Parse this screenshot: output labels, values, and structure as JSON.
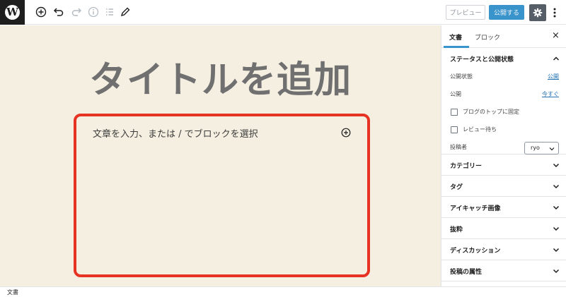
{
  "toolbar": {
    "logo_letter": "W",
    "logo_icon": "wordpress-logo-icon",
    "icons": [
      "add-block-icon",
      "undo-icon",
      "redo-icon",
      "info-icon",
      "list-view-icon",
      "edit-tools-icon"
    ],
    "preview_label": "プレビュー",
    "publish_label": "公開する",
    "settings_icon": "gear-icon",
    "more_icon": "more-vertical-icon"
  },
  "editor": {
    "title_placeholder": "タイトルを追加",
    "block_placeholder": "文章を入力、または / でブロックを選択",
    "highlight_color": "#e63323",
    "canvas_color": "#f4efe1"
  },
  "sidebar": {
    "tabs": {
      "document": "文書",
      "block": "ブロック",
      "close": "×"
    },
    "status_panel": {
      "title": "ステータスと公開状態",
      "visibility_label": "公開状態",
      "visibility_value": "公開",
      "publish_label": "公開",
      "publish_value": "今すぐ",
      "sticky_label": "ブログのトップに固定",
      "pending_label": "レビュー待ち",
      "author_label": "投稿者",
      "author_value": "ryo"
    },
    "panels": [
      "カテゴリー",
      "タグ",
      "アイキャッチ画像",
      "抜粋",
      "ディスカッション",
      "投稿の属性"
    ]
  },
  "footer": {
    "breadcrumb": "文書"
  },
  "colors": {
    "accent": "#3a94cc",
    "link": "#2271b1"
  }
}
